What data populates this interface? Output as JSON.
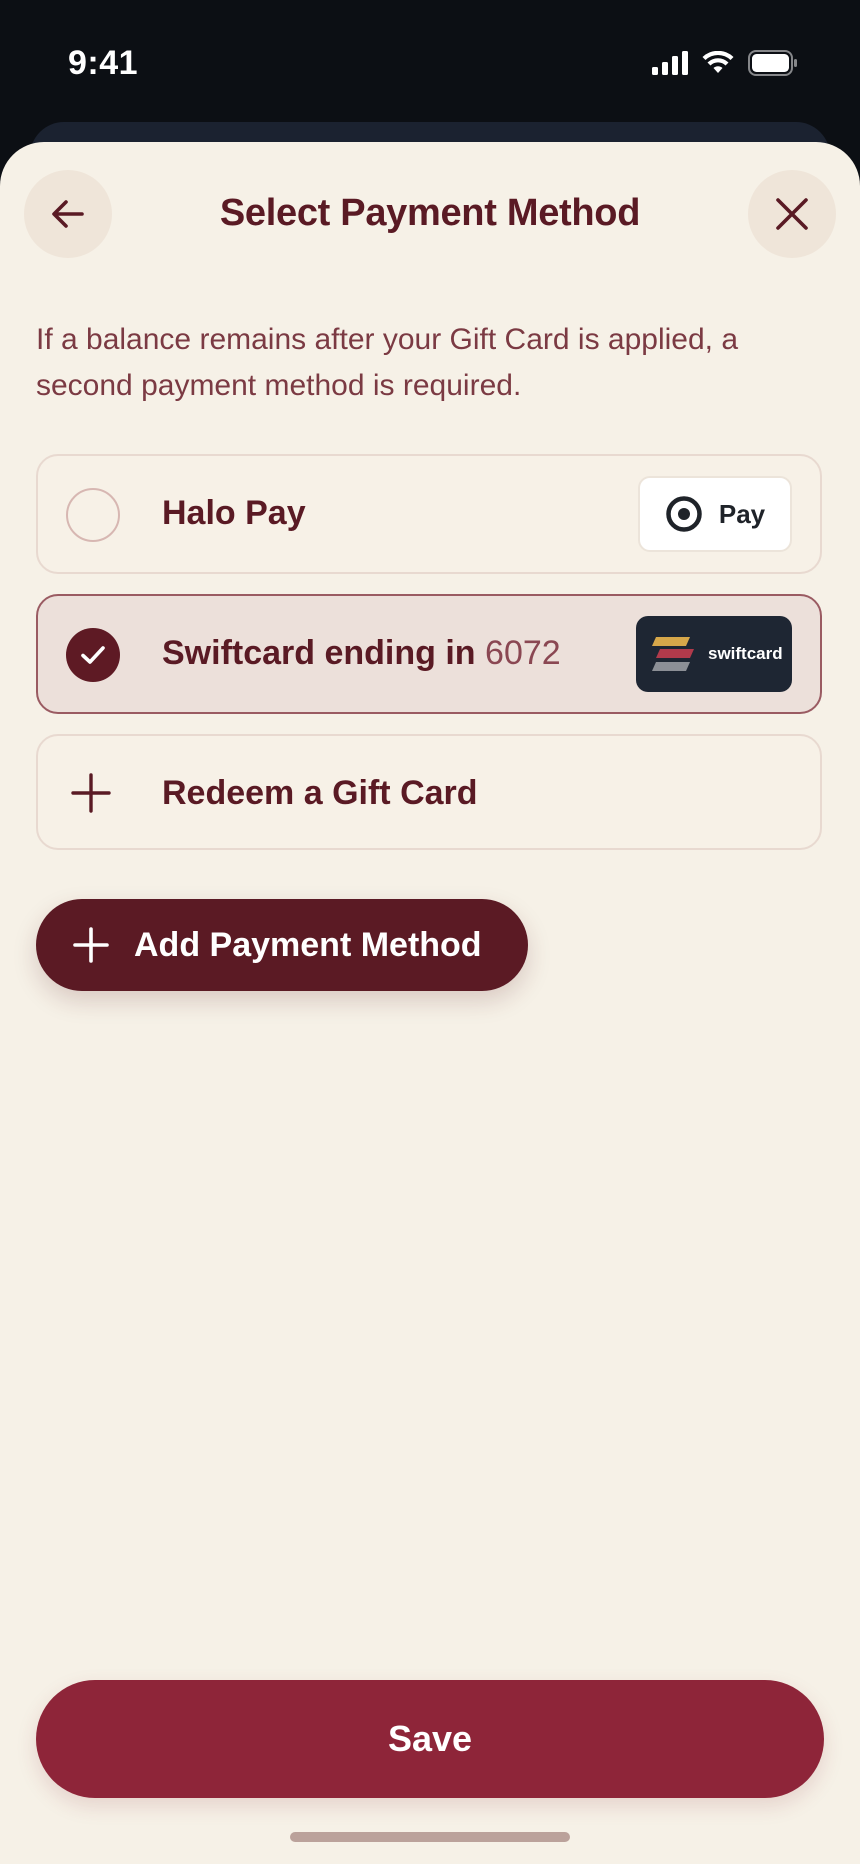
{
  "status_bar": {
    "time": "9:41"
  },
  "header": {
    "title": "Select Payment Method",
    "back_icon": "arrow-left-icon",
    "close_icon": "close-icon"
  },
  "notice": "If a balance remains after your Gift Card is applied, a second payment method is required.",
  "payment_options": [
    {
      "label": "Halo Pay",
      "selected": false,
      "badge_text": "Pay",
      "badge_icon": "target-ring-icon"
    },
    {
      "label": "Swiftcard ending in",
      "last4": "6072",
      "selected": true,
      "badge_text": "swiftcard",
      "badge_icon": "swiftcard-stripes-icon"
    },
    {
      "label": "Redeem a Gift Card",
      "icon": "plus-icon"
    }
  ],
  "add_button": {
    "label": "Add Payment Method",
    "icon": "plus-icon"
  },
  "save_button": {
    "label": "Save"
  },
  "colors": {
    "sheet_bg": "#f6f1e7",
    "primary": "#5b1a24",
    "save": "#8e2539",
    "text": "#5a1a24"
  }
}
